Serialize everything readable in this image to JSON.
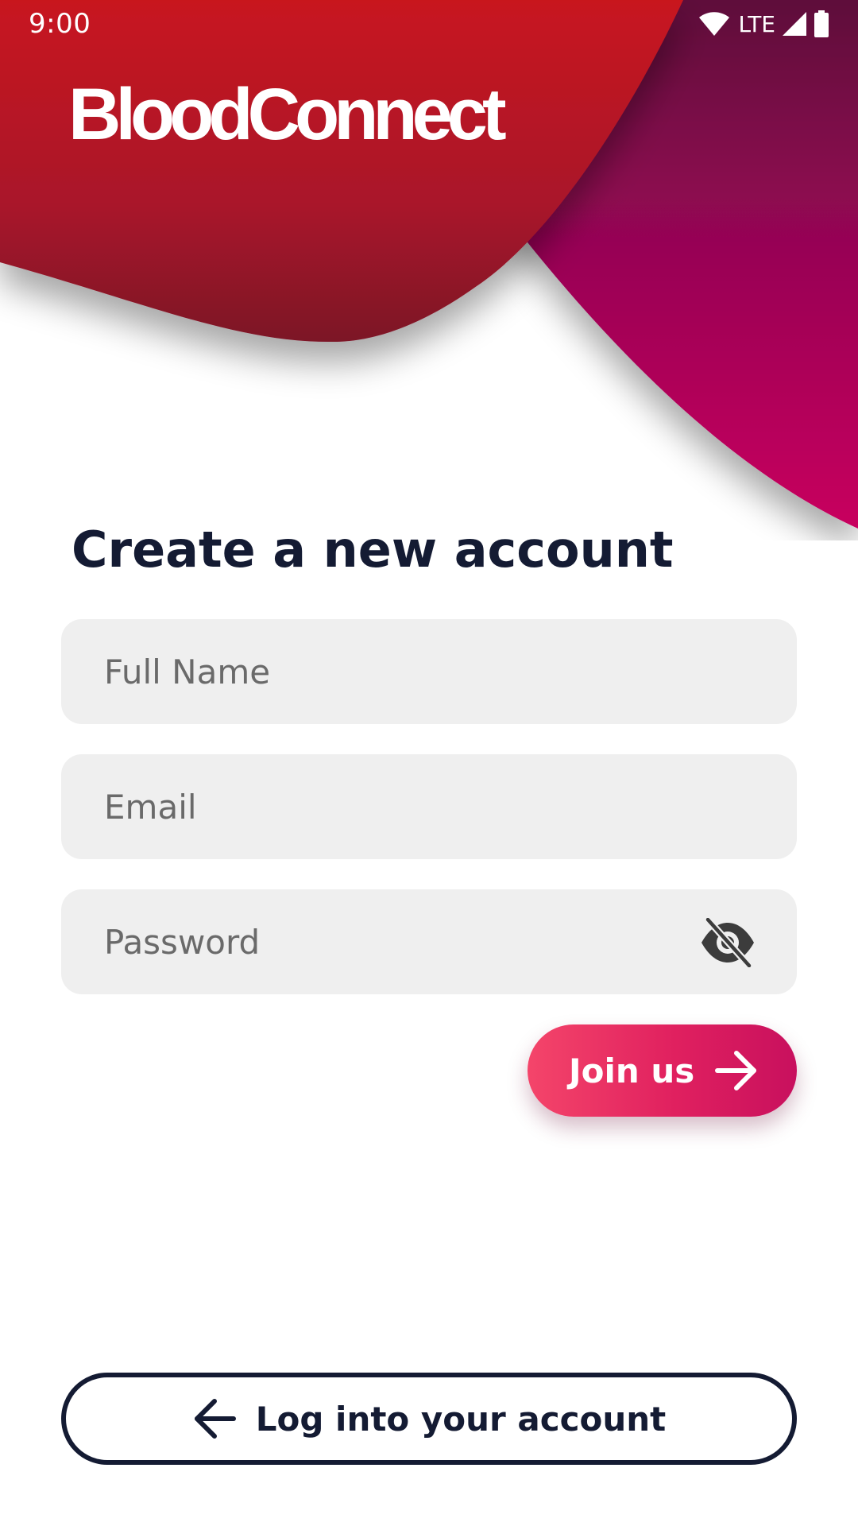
{
  "status_bar": {
    "time": "9:00",
    "network": "LTE"
  },
  "header": {
    "brand": "BloodConnect"
  },
  "form": {
    "title": "Create a new account",
    "full_name": {
      "value": "",
      "placeholder": "Full Name"
    },
    "email": {
      "value": "",
      "placeholder": "Email"
    },
    "password": {
      "value": "",
      "placeholder": "Password",
      "visibility_icon": "eye-off-icon"
    }
  },
  "actions": {
    "join_label": "Join us",
    "join_icon": "arrow-right-icon",
    "login_label": "Log into your account",
    "login_icon": "arrow-left-icon"
  },
  "colors": {
    "brand_red": "#c8161f",
    "brand_magenta": "#c2005f",
    "dark_navy": "#141b33",
    "field_bg": "#efefef",
    "button_gradient_start": "#f4456a",
    "button_gradient_end": "#c8105e"
  }
}
